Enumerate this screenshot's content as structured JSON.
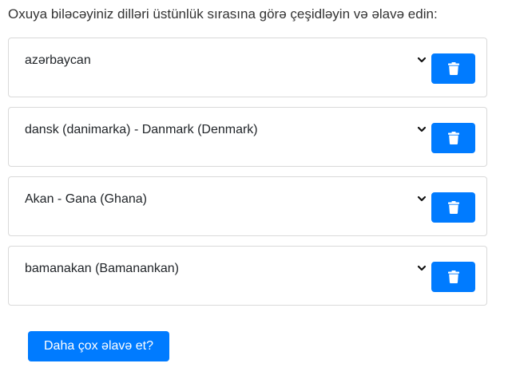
{
  "heading": "Oxuya biləcəyiniz dilləri üstünlük sırasına görə çeşidləyin və əlavə edin:",
  "languages": [
    {
      "label": "azərbaycan"
    },
    {
      "label": "dansk (danimarka) - Danmark (Denmark)"
    },
    {
      "label": "Akan - Gana (Ghana)"
    },
    {
      "label": "bamanakan (Bamanankan)"
    }
  ],
  "add_button_label": "Daha çox əlavə et?",
  "icons": {
    "select": "chevron-down-icon",
    "delete": "trash-icon"
  },
  "colors": {
    "accent": "#007bff",
    "border": "#d9d9d9",
    "text": "#212529"
  }
}
